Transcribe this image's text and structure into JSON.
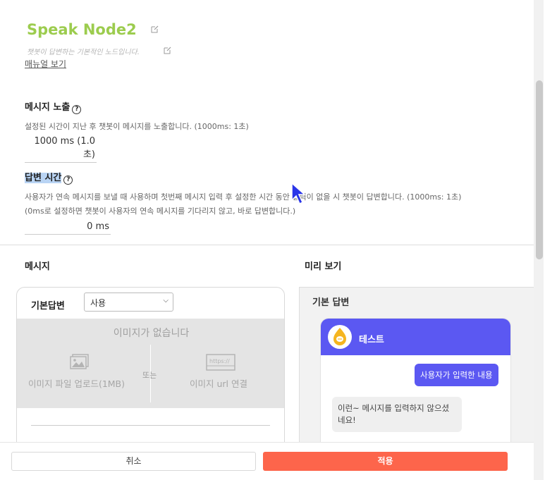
{
  "node": {
    "title": "Speak Node2",
    "subtitle": "챗봇이 답변하는 기본적인 노드입니다.",
    "manual_link": "매뉴얼 보기"
  },
  "exposure": {
    "title": "메시지 노출",
    "help": "?",
    "description": "설정된 시간이 지난 후 챗봇이 메시지를 노출합니다. (1000ms: 1초)",
    "value": "1000 ms (1.0초)"
  },
  "answer_time": {
    "title": "답변 시간",
    "help": "?",
    "description_line1": "사용자가 연속 메시지를 보낼 때 사용하며 첫번째 메시지 입력 후 설정한 시간 동안 입력이 없을 시 챗봇이 답변합니다. (1000ms: 1초)",
    "description_line2": "(0ms로 설정하면 챗봇이 사용자의 연속 메시지를 기다리지 않고, 바로 답변합니다.)",
    "value": "0 ms"
  },
  "message": {
    "section_title": "메시지",
    "label": "기본답변",
    "select_value": "사용",
    "no_image": "이미지가 없습니다",
    "upload_option": "이미지 파일 업로드(1MB)",
    "or_label": "또는",
    "url_option": "이미지 url 연결",
    "url_icon_text": "https://"
  },
  "preview": {
    "section_title": "미리 보기",
    "label": "기본 답변",
    "bot_name": "테스트",
    "user_message": "사용자가 입력한 내용",
    "bot_message": "이런~ 메시지를 입력하지 않으셨네요!"
  },
  "footer": {
    "cancel_label": "취소",
    "apply_label": "적용"
  },
  "colors": {
    "title_green": "#9ccc4e",
    "brand_purple": "#5b58f2",
    "apply_orange": "#fd654b",
    "highlight_blue": "#b9d4f4"
  }
}
